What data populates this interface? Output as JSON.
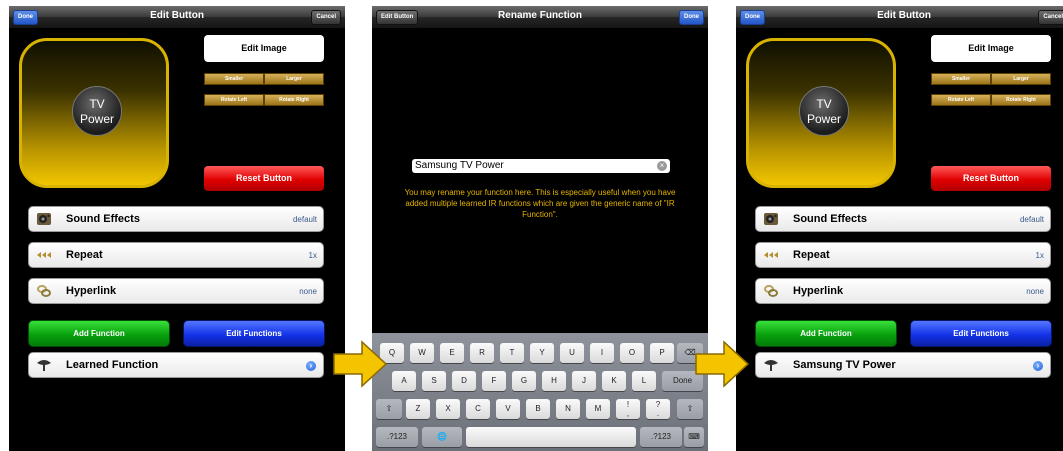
{
  "edit_screen": {
    "nav": {
      "left_button": "Done",
      "title": "Edit Button",
      "right_button": "Cancel"
    },
    "preview_label": "TV\nPower",
    "edit_image": "Edit Image",
    "size_buttons": [
      "Smaller",
      "Larger"
    ],
    "rotate_buttons": [
      "Rotate Left",
      "Rotate Right"
    ],
    "reset": "Reset Button",
    "rows": [
      {
        "icon": "speaker-icon",
        "label": "Sound Effects",
        "value": "default"
      },
      {
        "icon": "repeat-arrows-icon",
        "label": "Repeat",
        "value": "1x"
      },
      {
        "icon": "chain-link-icon",
        "label": "Hyperlink",
        "value": "none"
      }
    ],
    "add_function": "Add Function",
    "edit_functions": "Edit Functions",
    "function_icon": "satellite-dish-icon"
  },
  "screen1": {
    "function_label": "Learned Function"
  },
  "screen3": {
    "function_label": "Samsung TV Power"
  },
  "rename_screen": {
    "nav": {
      "left_button": "Edit Button",
      "title": "Rename Function",
      "right_button": "Done"
    },
    "field_value": "Samsung TV Power",
    "hint": "You may rename your function here.  This is especially useful when you have added multiple learned IR functions which are given the generic name of \"IR Function\".",
    "keyboard": {
      "row1": [
        "Q",
        "W",
        "E",
        "R",
        "T",
        "Y",
        "U",
        "I",
        "O",
        "P"
      ],
      "row2": [
        "A",
        "S",
        "D",
        "F",
        "G",
        "H",
        "J",
        "K",
        "L"
      ],
      "return": "Done",
      "row3": [
        "Z",
        "X",
        "C",
        "V",
        "B",
        "N",
        "M",
        "!\n,",
        "?\n."
      ],
      "numbers_key": ".?123"
    }
  },
  "colors": {
    "arrow": "#f5c400",
    "gold": "#d8b300",
    "reset_red": "#e00000",
    "add_green": "#08a10d",
    "edit_blue": "#1433e8",
    "hint_text": "#e5b400"
  }
}
